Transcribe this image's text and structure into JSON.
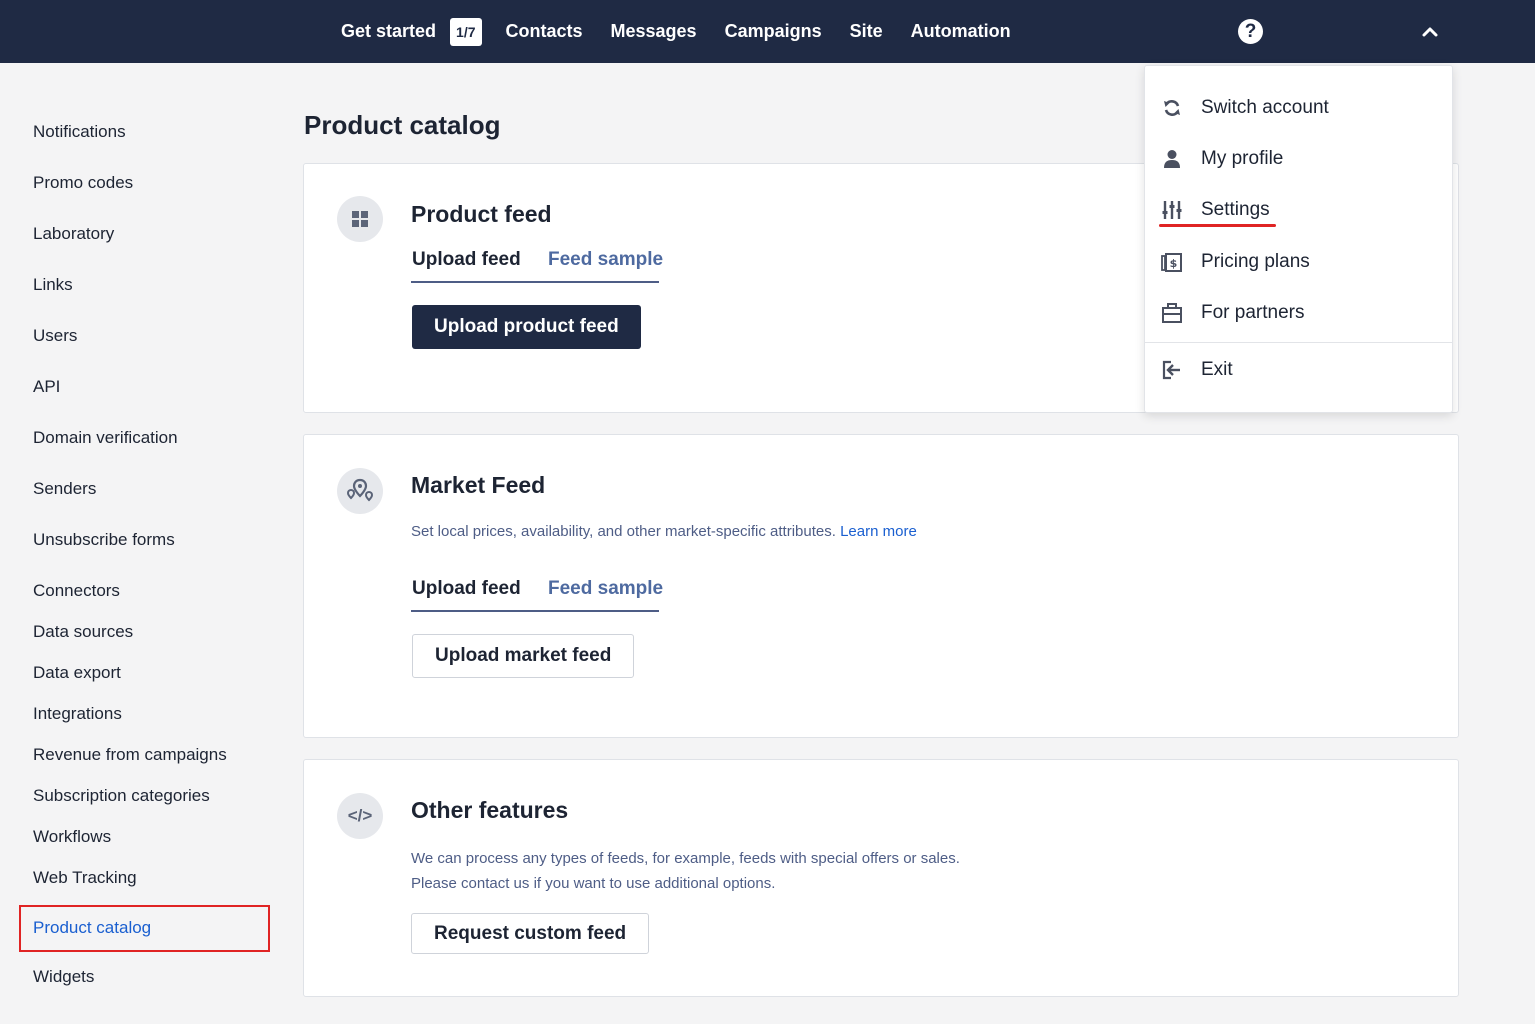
{
  "topnav": {
    "get_started": "Get started",
    "progress": "1/7",
    "items": [
      "Contacts",
      "Messages",
      "Campaigns",
      "Site",
      "Automation"
    ],
    "help": "?"
  },
  "sidebar": {
    "items": [
      "Notifications",
      "Promo codes",
      "Laboratory",
      "Links",
      "Users",
      "API",
      "Domain verification",
      "Senders",
      "Unsubscribe forms",
      "Connectors",
      "Data sources",
      "Data export",
      "Integrations",
      "Revenue from campaigns",
      "Subscription categories",
      "Workflows",
      "Web Tracking",
      "Product catalog",
      "Widgets"
    ],
    "active": "Product catalog"
  },
  "page": {
    "title": "Product catalog"
  },
  "product_feed": {
    "title": "Product feed",
    "tab_upload": "Upload feed",
    "tab_sample": "Feed sample",
    "button": "Upload product feed"
  },
  "market_feed": {
    "title": "Market Feed",
    "description": "Set local prices, availability, and other market-specific attributes.",
    "learn_more": "Learn more",
    "tab_upload": "Upload feed",
    "tab_sample": "Feed sample",
    "button": "Upload market feed"
  },
  "other_features": {
    "title": "Other features",
    "icon_text": "</>",
    "line1": "We can process any types of feeds, for example, feeds with special offers or sales.",
    "line2": "Please contact us if you want to use additional options.",
    "button": "Request custom feed"
  },
  "account_menu": {
    "items": [
      "Switch account",
      "My profile",
      "Settings",
      "Pricing plans",
      "For partners"
    ],
    "exit": "Exit"
  },
  "colors": {
    "topbar": "#1f2a44",
    "link": "#1a5fd0",
    "highlight": "#e02424"
  }
}
